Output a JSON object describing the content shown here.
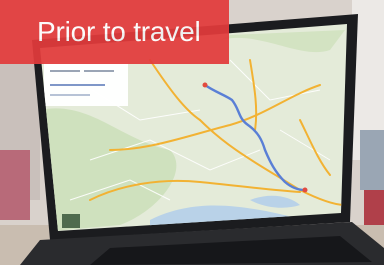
{
  "banner": {
    "text": "Prior to travel",
    "color": "#e23b3b"
  },
  "photo": {
    "subject": "laptop-with-route-map",
    "map_palette": {
      "land": "#e6eddc",
      "water": "#b9d2e8",
      "major_road": "#f2b233",
      "route": "#5a7fd6"
    }
  }
}
